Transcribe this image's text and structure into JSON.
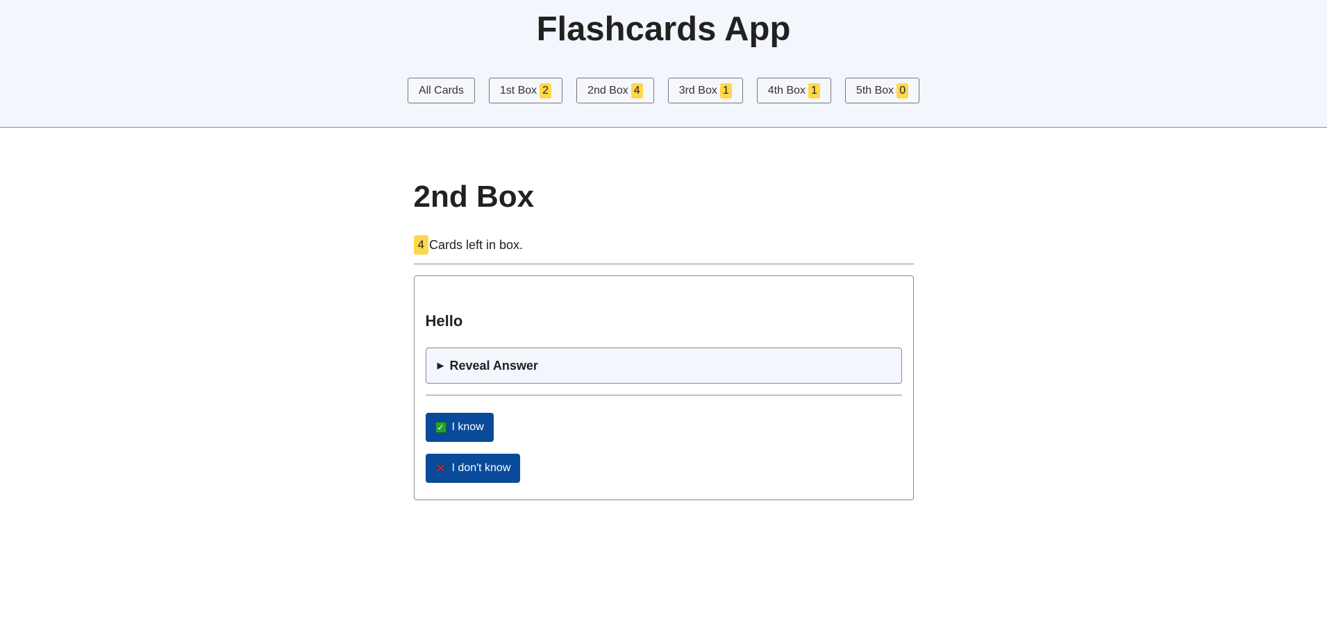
{
  "header": {
    "title": "Flashcards App",
    "nav": [
      {
        "label": "All Cards",
        "count": null
      },
      {
        "label": "1st Box",
        "count": "2"
      },
      {
        "label": "2nd Box",
        "count": "4"
      },
      {
        "label": "3rd Box",
        "count": "1"
      },
      {
        "label": "4th Box",
        "count": "1"
      },
      {
        "label": "5th Box",
        "count": "0"
      }
    ]
  },
  "main": {
    "box_title": "2nd Box",
    "remaining_count": "4",
    "remaining_text": "Cards left in box.",
    "card": {
      "question": "Hello",
      "reveal_label": "Reveal Answer",
      "know_label": "I know",
      "dont_know_label": "I don't know"
    }
  },
  "colors": {
    "header_bg": "#f3f6fc",
    "badge": "#ffd74a",
    "primary_button": "#0a4a9a"
  },
  "icons": {
    "reveal": "triangle-right-icon",
    "know": "check-mark-icon",
    "dont_know": "cross-mark-icon"
  }
}
